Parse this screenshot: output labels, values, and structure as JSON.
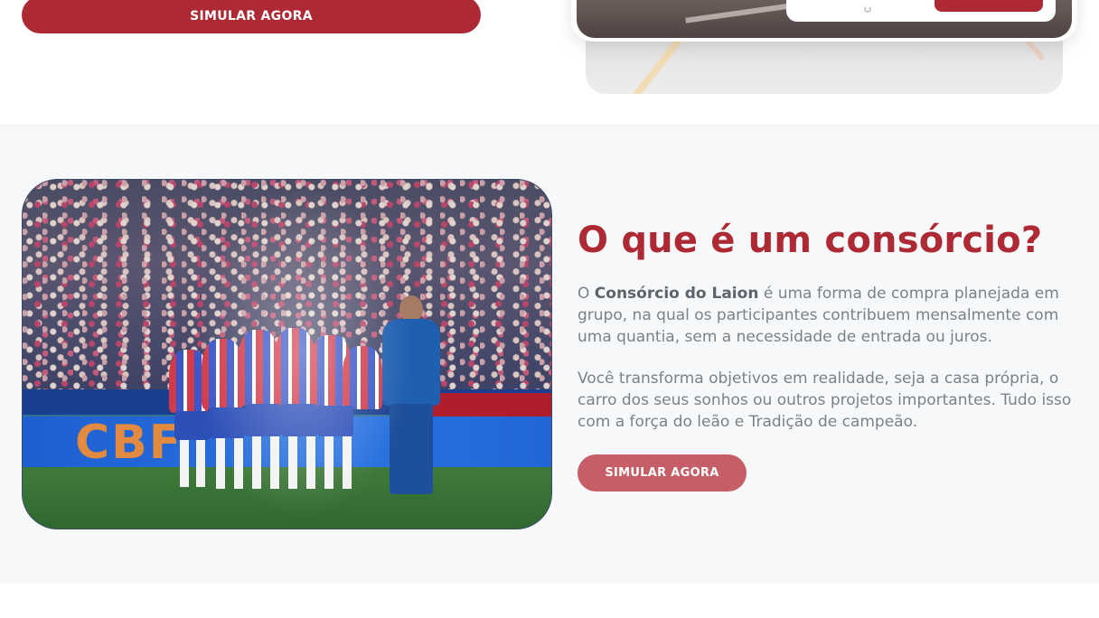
{
  "top": {
    "cta_label": "SIMULAR AGORA"
  },
  "consorcio": {
    "title": "O que é um consórcio?",
    "para1_prefix": "O ",
    "para1_brand": "Consórcio do Laion",
    "para1_suffix": " é uma forma de compra planejada em grupo, na qual os participantes contribuem mensalmente com uma quantia, sem a necessidade de entrada ou juros.",
    "para2": "Você transforma objetivos em realidade, seja a casa própria, o carro dos seus sonhos ou outros projetos importantes. Tudo isso com a força do leão e Tradição de campeão.",
    "cta_label": "SIMULAR AGORA",
    "photo_board_text": "CBF"
  },
  "colors": {
    "brand_red": "#ad2a34",
    "cta_muted": "#c65e68",
    "section_bg": "#f7f8fa",
    "body_text": "#7c8089"
  }
}
